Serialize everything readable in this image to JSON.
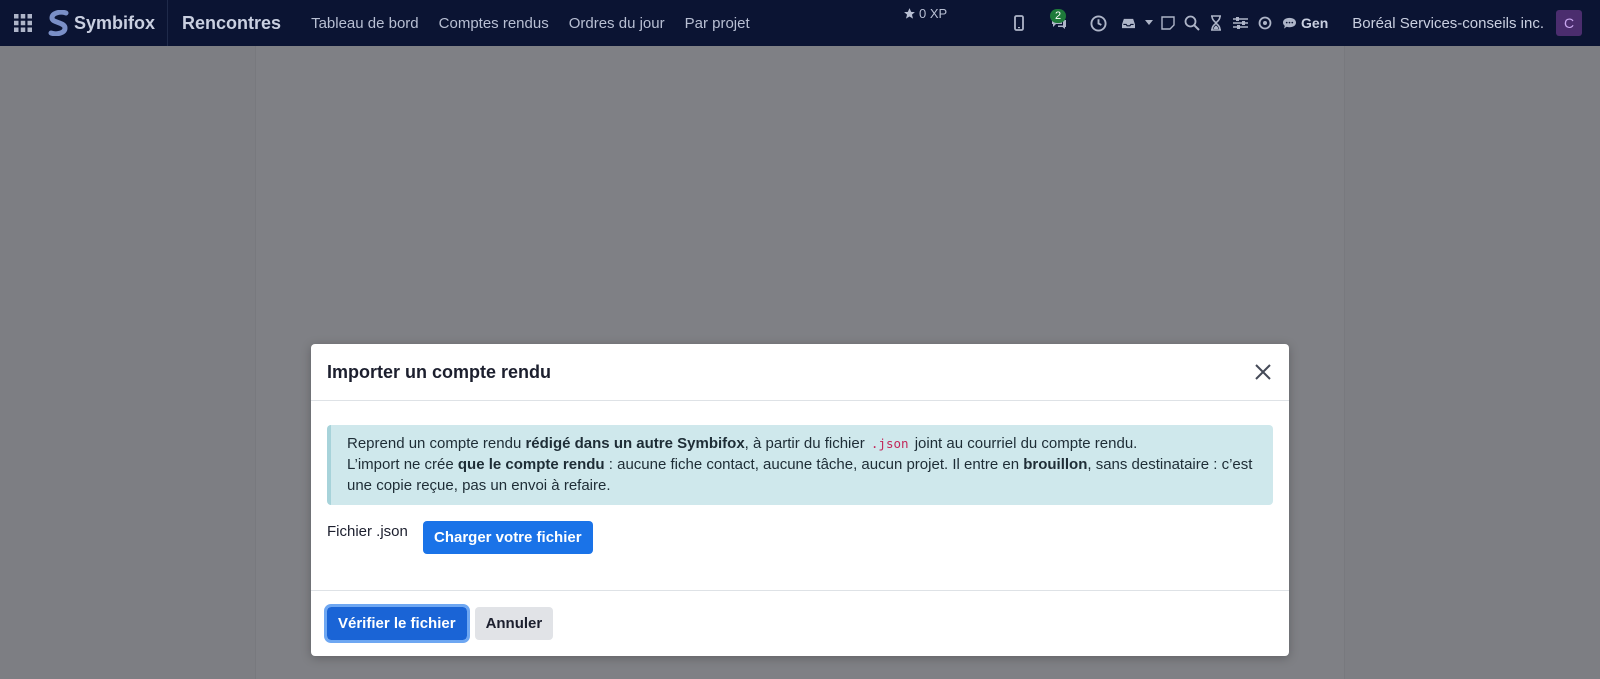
{
  "navbar": {
    "brand": "Symbifox",
    "app_title": "Rencontres",
    "menu": [
      {
        "label": "Tableau de bord"
      },
      {
        "label": "Comptes rendus"
      },
      {
        "label": "Ordres du jour"
      },
      {
        "label": "Par projet"
      }
    ],
    "xp": "0 XP",
    "messages_count": "2",
    "gen_label": "Gen",
    "company": "Boréal Services-conseils inc.",
    "avatar_initial": "C",
    "icons": [
      "apps-grid-icon",
      "brand-logo-icon",
      "star-icon",
      "mobile-icon",
      "chat-icon",
      "clock-icon",
      "inbox-icon",
      "caret-down-icon",
      "note-icon",
      "search-icon",
      "hourglass-icon",
      "sliders-icon",
      "sun-icon",
      "speech-bubble-icon"
    ]
  },
  "modal": {
    "title": "Importer un compte rendu",
    "alert": {
      "line1_a": "Reprend un compte rendu ",
      "line1_b": "rédigé dans un autre Symbifox",
      "line1_c": ", à partir du fichier ",
      "line1_code": ".json",
      "line1_d": " joint au courriel du compte rendu.",
      "line2_a": "L’import ne crée ",
      "line2_b": "que le compte rendu",
      "line2_c": " : aucune fiche contact, aucune tâche, aucun projet. Il entre en ",
      "line2_d": "brouillon",
      "line2_e": ", sans destinataire : c’est une copie reçue, pas un envoi à refaire."
    },
    "file_label": "Fichier .json",
    "upload_button": "Charger votre fichier",
    "verify_button": "Vérifier le fichier",
    "cancel_button": "Annuler"
  },
  "colors": {
    "navbar_bg": "#0b1433",
    "backdrop": "#7d7e83",
    "primary": "#1a73e8",
    "alert_bg": "#cfe8ec",
    "badge": "#1e7a3a",
    "avatar_bg": "#4b2d6e"
  }
}
